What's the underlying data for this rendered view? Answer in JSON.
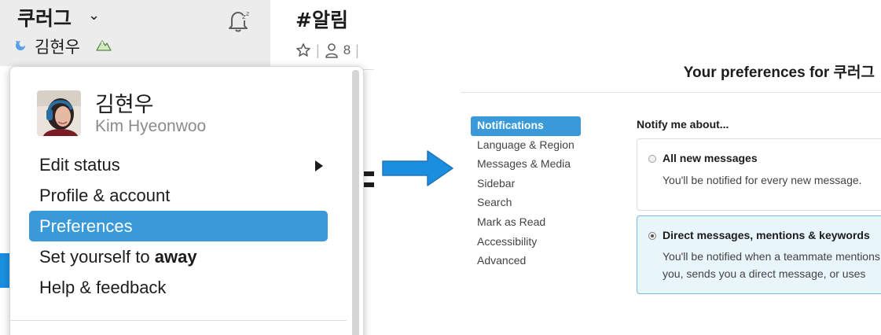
{
  "sidebar": {
    "workspace_name": "쿠러그",
    "workspace_chevron": "⌄",
    "user_name": "김현우"
  },
  "channel": {
    "title": "#알림",
    "member_count": "8",
    "star_icon": "star-icon",
    "members_icon": "person-icon"
  },
  "user_menu": {
    "display_name": "김현우",
    "full_name": "Kim Hyeonwoo",
    "items": [
      {
        "label": "Edit status"
      },
      {
        "label": "Profile & account"
      },
      {
        "label": "Preferences"
      },
      {
        "label_prefix": "Set yourself to ",
        "label_bold": "away"
      },
      {
        "label": "Help & feedback"
      }
    ],
    "active_item": "Preferences"
  },
  "preferences": {
    "title": "Your preferences for 쿠러그",
    "nav": [
      "Notifications",
      "Language & Region",
      "Messages & Media",
      "Sidebar",
      "Search",
      "Mark as Read",
      "Accessibility",
      "Advanced"
    ],
    "active_nav": "Notifications",
    "notify_label": "Notify me about...",
    "options": [
      {
        "title": "All new messages",
        "description": "You'll be notified for every new message.",
        "selected": false
      },
      {
        "title": "Direct messages, mentions & keywords",
        "description": "You'll be notified when a teammate mentions you, sends you a direct message, or uses",
        "selected": true
      }
    ]
  },
  "colors": {
    "accent": "#3a9ad9",
    "arrow": "#1a8fe0",
    "selected_card_bg": "#e8f5fa",
    "header_bg": "#ececec"
  }
}
